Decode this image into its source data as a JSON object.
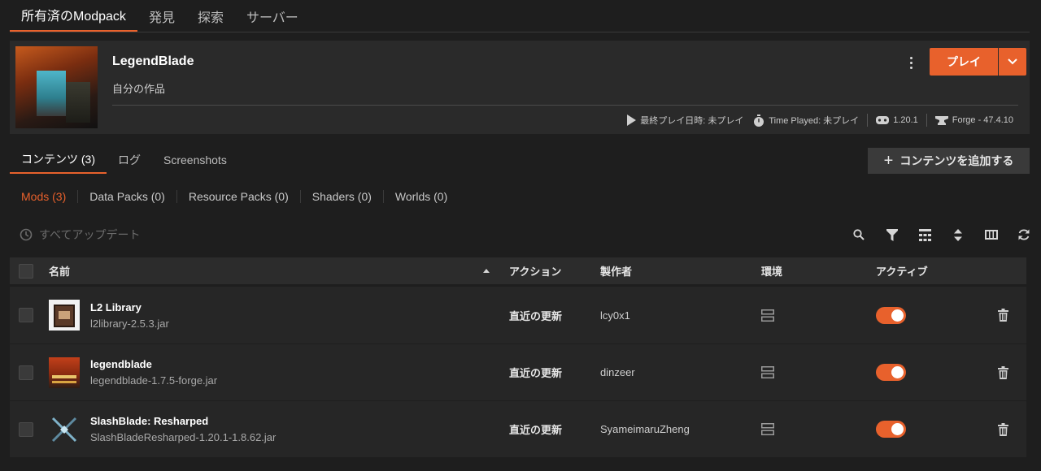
{
  "top_tabs": [
    "所有済のModpack",
    "発見",
    "探索",
    "サーバー"
  ],
  "header": {
    "title": "LegendBlade",
    "subtitle": "自分の作品",
    "play_label": "プレイ",
    "last_played": "最終プレイ日時: 未プレイ",
    "time_played": "Time Played: 未プレイ",
    "mc_version": "1.20.1",
    "loader": "Forge - 47.4.10"
  },
  "content_tabs": [
    "コンテンツ (3)",
    "ログ",
    "Screenshots"
  ],
  "add_content_label": "コンテンツを追加する",
  "filters": [
    "Mods (3)",
    "Data Packs (0)",
    "Resource Packs (0)",
    "Shaders (0)",
    "Worlds (0)"
  ],
  "update_all_label": "すべてアップデート",
  "table": {
    "headers": {
      "name": "名前",
      "action": "アクション",
      "author": "製作者",
      "env": "環境",
      "active": "アクティブ"
    },
    "rows": [
      {
        "name": "L2 Library",
        "file": "l2library-2.5.3.jar",
        "action": "直近の更新",
        "author": "lcy0x1",
        "active": true
      },
      {
        "name": "legendblade",
        "file": "legendblade-1.7.5-forge.jar",
        "action": "直近の更新",
        "author": "dinzeer",
        "active": true
      },
      {
        "name": "SlashBlade: Resharped",
        "file": "SlashBladeResharped-1.20.1-1.8.62.jar",
        "action": "直近の更新",
        "author": "SyameimaruZheng",
        "active": true
      }
    ]
  },
  "colors": {
    "accent": "#e8612c",
    "background": "#1e1e1e",
    "card": "#2a2a2a"
  }
}
